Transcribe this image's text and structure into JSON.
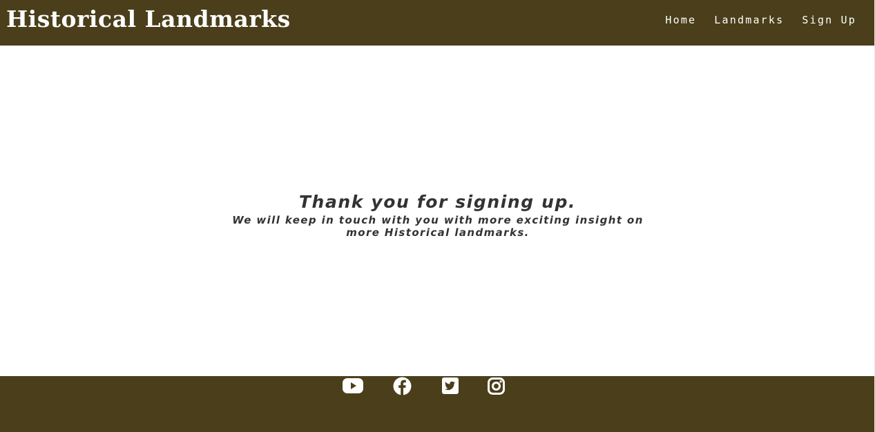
{
  "header": {
    "brand": "Historical Landmarks",
    "nav": [
      {
        "label": "Home"
      },
      {
        "label": "Landmarks"
      },
      {
        "label": "Sign Up"
      }
    ]
  },
  "main": {
    "heading": "Thank you for signing up.",
    "message": "We will keep in touch with you with more exciting insight on more Historical landmarks."
  },
  "footer": {
    "social": [
      {
        "icon": "youtube-icon"
      },
      {
        "icon": "facebook-icon"
      },
      {
        "icon": "twitter-icon"
      },
      {
        "icon": "instagram-icon"
      }
    ]
  },
  "colors": {
    "brand_bar": "#4a3f1a",
    "text_dark": "#333333",
    "text_light": "#ffffff"
  }
}
